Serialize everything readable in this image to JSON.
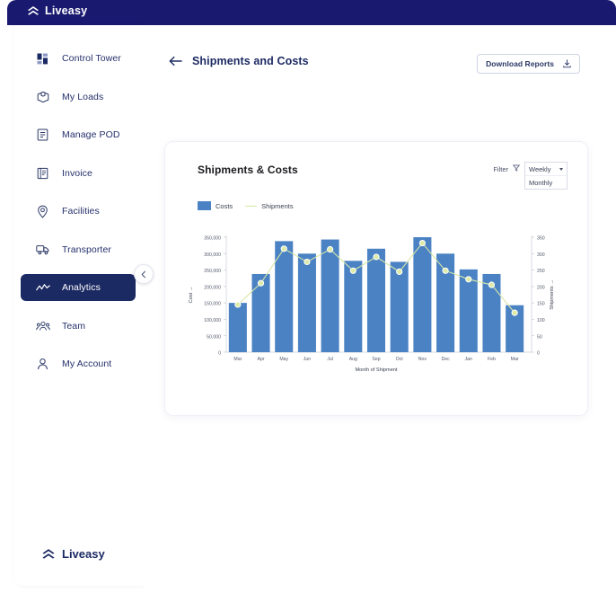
{
  "brand": {
    "name": "Liveasy",
    "logo_icon": "double-chevron-up-icon",
    "top_bar_color": "#191970",
    "accent_color": "#1c2a63"
  },
  "sidebar": {
    "collapse_button_icon": "chevron-left-icon",
    "items": [
      {
        "label": "Control Tower",
        "icon": "dashboard-grid-icon",
        "active": false
      },
      {
        "label": "My Loads",
        "icon": "box-package-icon",
        "active": false
      },
      {
        "label": "Manage POD",
        "icon": "document-list-icon",
        "active": false
      },
      {
        "label": "Invoice",
        "icon": "invoice-receipt-icon",
        "active": false
      },
      {
        "label": "Facilities",
        "icon": "map-pin-icon",
        "active": false
      },
      {
        "label": "Transporter",
        "icon": "truck-icon",
        "active": false
      },
      {
        "label": "Analytics",
        "icon": "line-chart-icon",
        "active": true
      },
      {
        "label": "Team",
        "icon": "people-group-icon",
        "active": false
      },
      {
        "label": "My Account",
        "icon": "user-person-icon",
        "active": false
      }
    ],
    "footer_brand": "Liveasy"
  },
  "header": {
    "back_icon": "arrow-left-icon",
    "title": "Shipments and Costs",
    "download_button": {
      "label": "Download Reports",
      "icon": "download-tray-icon"
    }
  },
  "card": {
    "title": "Shipments & Costs",
    "filter": {
      "label": "Filter",
      "icon": "filter-funnel-icon",
      "selected": "Weekly",
      "options": [
        "Weekly",
        "Monthly"
      ],
      "expanded": true
    },
    "legend": [
      {
        "label": "Costs",
        "type": "bar",
        "color": "#4a82c4"
      },
      {
        "label": "Shipments",
        "type": "line",
        "color": "#d7e6a5"
      }
    ]
  },
  "chart_data": {
    "type": "bar",
    "title": "Shipments & Costs",
    "xlabel": "Month of Shipment",
    "ylabel": "Cost →",
    "y2label": "Shipments →",
    "grid": false,
    "legend_position": "top-left",
    "categories": [
      "Mar",
      "Apr",
      "May",
      "Jun",
      "Jul",
      "Aug",
      "Sep",
      "Oct",
      "Nov",
      "Dec",
      "Jan",
      "Feb",
      "Mar"
    ],
    "ylim": [
      0,
      350000
    ],
    "yticks": [
      0,
      50000,
      100000,
      150000,
      200000,
      250000,
      300000,
      350000
    ],
    "ytick_labels": [
      "0",
      "50,000",
      "100,000",
      "150,000",
      "200,000",
      "250,000",
      "300,000",
      "350,000"
    ],
    "y2lim": [
      0,
      350
    ],
    "y2ticks": [
      0,
      50,
      100,
      150,
      200,
      250,
      300,
      350
    ],
    "y2tick_labels": [
      "0",
      "50",
      "100",
      "150",
      "200",
      "250",
      "300",
      "350"
    ],
    "series": [
      {
        "name": "Costs",
        "type": "bar",
        "axis": "left",
        "color": "#4a82c4",
        "values": [
          150000,
          238000,
          338000,
          300000,
          343000,
          278000,
          315000,
          275000,
          350000,
          300000,
          252000,
          238000,
          143000
        ]
      },
      {
        "name": "Shipments",
        "type": "line",
        "axis": "right",
        "color": "#d7e6a5",
        "marker_fill": "#ddeba8",
        "marker_stroke": "#ffffff",
        "values": [
          145,
          210,
          315,
          275,
          313,
          248,
          290,
          245,
          332,
          248,
          222,
          205,
          120
        ]
      }
    ]
  }
}
